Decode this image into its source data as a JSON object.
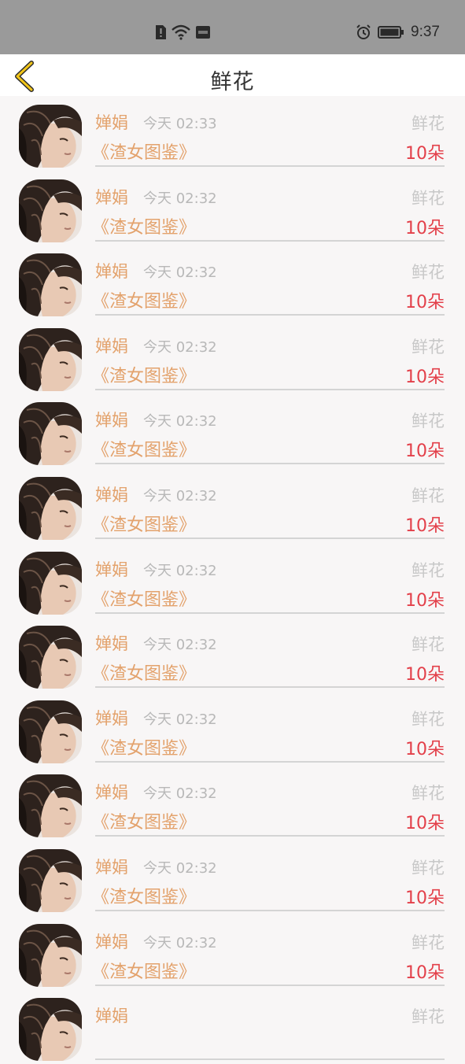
{
  "status_bar": {
    "time": "9:37"
  },
  "header": {
    "title": "鲜花"
  },
  "rows": [
    {
      "name": "婵娟",
      "time": "今天 02:33",
      "type": "鲜花",
      "book": "《渣女图鉴》",
      "count": "10朵"
    },
    {
      "name": "婵娟",
      "time": "今天 02:32",
      "type": "鲜花",
      "book": "《渣女图鉴》",
      "count": "10朵"
    },
    {
      "name": "婵娟",
      "time": "今天 02:32",
      "type": "鲜花",
      "book": "《渣女图鉴》",
      "count": "10朵"
    },
    {
      "name": "婵娟",
      "time": "今天 02:32",
      "type": "鲜花",
      "book": "《渣女图鉴》",
      "count": "10朵"
    },
    {
      "name": "婵娟",
      "time": "今天 02:32",
      "type": "鲜花",
      "book": "《渣女图鉴》",
      "count": "10朵"
    },
    {
      "name": "婵娟",
      "time": "今天 02:32",
      "type": "鲜花",
      "book": "《渣女图鉴》",
      "count": "10朵"
    },
    {
      "name": "婵娟",
      "time": "今天 02:32",
      "type": "鲜花",
      "book": "《渣女图鉴》",
      "count": "10朵"
    },
    {
      "name": "婵娟",
      "time": "今天 02:32",
      "type": "鲜花",
      "book": "《渣女图鉴》",
      "count": "10朵"
    },
    {
      "name": "婵娟",
      "time": "今天 02:32",
      "type": "鲜花",
      "book": "《渣女图鉴》",
      "count": "10朵"
    },
    {
      "name": "婵娟",
      "time": "今天 02:32",
      "type": "鲜花",
      "book": "《渣女图鉴》",
      "count": "10朵"
    },
    {
      "name": "婵娟",
      "time": "今天 02:32",
      "type": "鲜花",
      "book": "《渣女图鉴》",
      "count": "10朵"
    },
    {
      "name": "婵娟",
      "time": "今天 02:32",
      "type": "鲜花",
      "book": "《渣女图鉴》",
      "count": "10朵"
    },
    {
      "name": "婵娟",
      "time": "",
      "type": "鲜花",
      "book": "",
      "count": ""
    }
  ],
  "colors": {
    "name": "#e3a26c",
    "count": "#e3404a",
    "back_arrow": "#f0c419"
  },
  "icons": {
    "back": "chevron-left-icon",
    "alarm": "alarm-icon",
    "battery": "battery-icon",
    "wifi": "wifi-icon",
    "sim": "sim-alert-icon"
  }
}
